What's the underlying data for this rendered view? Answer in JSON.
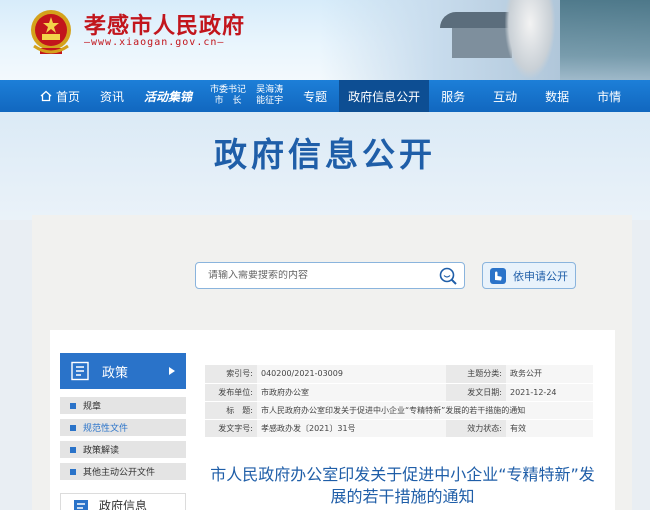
{
  "header": {
    "site_title": "孝感市人民政府",
    "site_url": "—www.xiaogan.gov.cn—"
  },
  "nav": {
    "items": [
      {
        "label": "首页",
        "icon": "home-icon"
      },
      {
        "label": "资讯"
      },
      {
        "label": "活动集锦"
      },
      {
        "label_line1": "市委书记",
        "label_line2": "市　长"
      },
      {
        "label_line1": "吴海涛",
        "label_line2": "能征宇"
      },
      {
        "label": "专题"
      },
      {
        "label": "政府信息公开",
        "active": true
      },
      {
        "label": "服务"
      },
      {
        "label": "互动"
      },
      {
        "label": "数据"
      },
      {
        "label": "市情"
      }
    ]
  },
  "hero": {
    "title": "政府信息公开"
  },
  "search": {
    "placeholder": "请输入需要搜索的内容",
    "apply_label": "依申请公开"
  },
  "sidebar": {
    "head_label": "政策",
    "items": [
      {
        "label": "规章"
      },
      {
        "label": "规范性文件",
        "active": true
      },
      {
        "label": "政策解读"
      },
      {
        "label": "其他主动公开文件"
      }
    ],
    "head2_label": "政府信息"
  },
  "info": {
    "rows": [
      {
        "k1": "索引号:",
        "v1": "040200/2021-03009",
        "k2": "主题分类:",
        "v2": "政务公开"
      },
      {
        "k1": "发布单位:",
        "v1": "市政府办公室",
        "k2": "发文日期:",
        "v2": "2021-12-24"
      },
      {
        "k1": "标　题:",
        "v1": "市人民政府办公室印发关于促进中小企业“专精特新”发展的若干措施的通知"
      },
      {
        "k1": "发文字号:",
        "v1": "孝感政办发〔2021〕31号",
        "k2": "效力状态:",
        "v2": "有效"
      }
    ]
  },
  "document": {
    "title": "市人民政府办公室印发关于促进中小企业“专精特新”发展的若干措施的通知"
  },
  "colors": {
    "brand_red": "#c2151c",
    "nav_blue": "#1167bf",
    "nav_active": "#0d4e93",
    "accent_blue": "#1f5ea8"
  }
}
